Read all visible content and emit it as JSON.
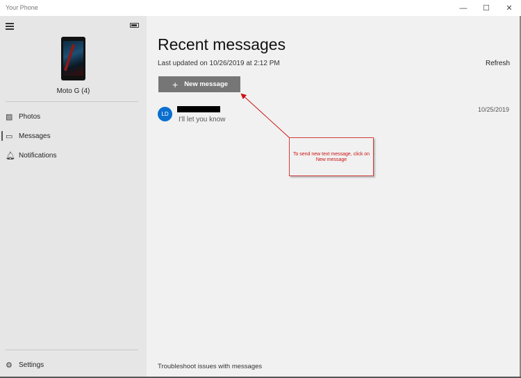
{
  "window": {
    "title": "Your Phone",
    "controls": {
      "minimize": "—",
      "maximize": "☐",
      "close": "✕"
    }
  },
  "sidebar": {
    "device_name": "Moto G (4)",
    "nav_items": [
      {
        "label": "Photos",
        "icon": "photos-icon",
        "glyph": "▨"
      },
      {
        "label": "Messages",
        "icon": "chat-icon",
        "glyph": "▭"
      },
      {
        "label": "Notifications",
        "icon": "bell-icon",
        "glyph": "🔔︎"
      }
    ],
    "settings": {
      "label": "Settings",
      "icon": "gear-icon",
      "glyph": "⚙"
    }
  },
  "main": {
    "heading": "Recent messages",
    "last_updated": "Last updated on 10/26/2019 at 2:12 PM",
    "refresh_label": "Refresh",
    "new_message_label": "New message",
    "conversations": [
      {
        "initials": "LD",
        "preview": "I'll let you know",
        "date": "10/25/2019"
      }
    ],
    "troubleshoot_link": "Troubleshoot issues with messages"
  },
  "annotation": {
    "text": "To send new text message, click on New message"
  },
  "colors": {
    "sidebar_bg": "#e6e6e6",
    "main_bg": "#f1f1f1",
    "button_bg": "#767676",
    "avatar_bg": "#0a6fcf",
    "annotation_red": "#cc1111"
  }
}
